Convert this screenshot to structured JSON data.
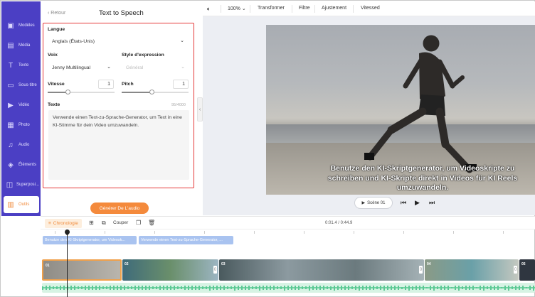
{
  "sidebar": {
    "items": [
      {
        "label": "Modèles",
        "icon": "templates-icon"
      },
      {
        "label": "Média",
        "icon": "media-icon"
      },
      {
        "label": "Texte",
        "icon": "text-icon"
      },
      {
        "label": "Sous-titre",
        "icon": "subtitle-icon"
      },
      {
        "label": "Vidéo",
        "icon": "video-icon"
      },
      {
        "label": "Photo",
        "icon": "photo-icon"
      },
      {
        "label": "Audio",
        "icon": "audio-icon"
      },
      {
        "label": "Éléments",
        "icon": "elements-icon"
      },
      {
        "label": "Superposi...",
        "icon": "overlay-icon"
      },
      {
        "label": "Outils",
        "icon": "tools-icon",
        "active": true
      }
    ]
  },
  "panel": {
    "back_label": "Retour",
    "title": "Text to Speech",
    "language_label": "Langue",
    "language_value": "Anglais (États-Unis)",
    "voice_label": "Voix",
    "voice_value": "Jenny Multilingual",
    "style_label": "Style d'expression",
    "style_value": "Général",
    "speed_label": "Vitesse",
    "speed_value": "1",
    "speed_fraction": 0.3,
    "pitch_label": "Pitch",
    "pitch_value": "1",
    "pitch_fraction": 0.45,
    "text_label": "Texte",
    "char_count": "95/4000",
    "text_value": "Verwende einen Text-zu-Sprache-Generator, um Text in eine KI-Stimme für dein Video umzuwandeln.",
    "generate_label": "Générer De L'audio"
  },
  "toolbar": {
    "zoom": "100%",
    "transform": "Transformer",
    "filter": "Filtre",
    "adjust": "Ajustement",
    "speed": "Vitessed"
  },
  "preview": {
    "subtitle": "Benutze den KI-Skriptgenerator, um Videoskripte zu schreiben und KI-Skripte direkt in Videos für KI Reels umzuwandeln.",
    "scene_label": "Scène 01"
  },
  "timeline": {
    "chrono_label": "Chronologie",
    "cut_label": "Couper",
    "time": "0:01.4 / 0:44.9",
    "text_clip_1": "Benutze den KI-Skriptgenerator, um Videosk...",
    "text_clip_2": "Verwende einen Text-zu-Sprache-Generator, ...",
    "clip_numbers": [
      "01",
      "02",
      "03",
      "04",
      "05"
    ]
  },
  "colors": {
    "rail": "#4b3fc4",
    "accent": "#f48a3c",
    "highlight_border": "#e53a3a",
    "text_clip": "#a9c3f0",
    "audio_track": "#d7f3e4"
  }
}
